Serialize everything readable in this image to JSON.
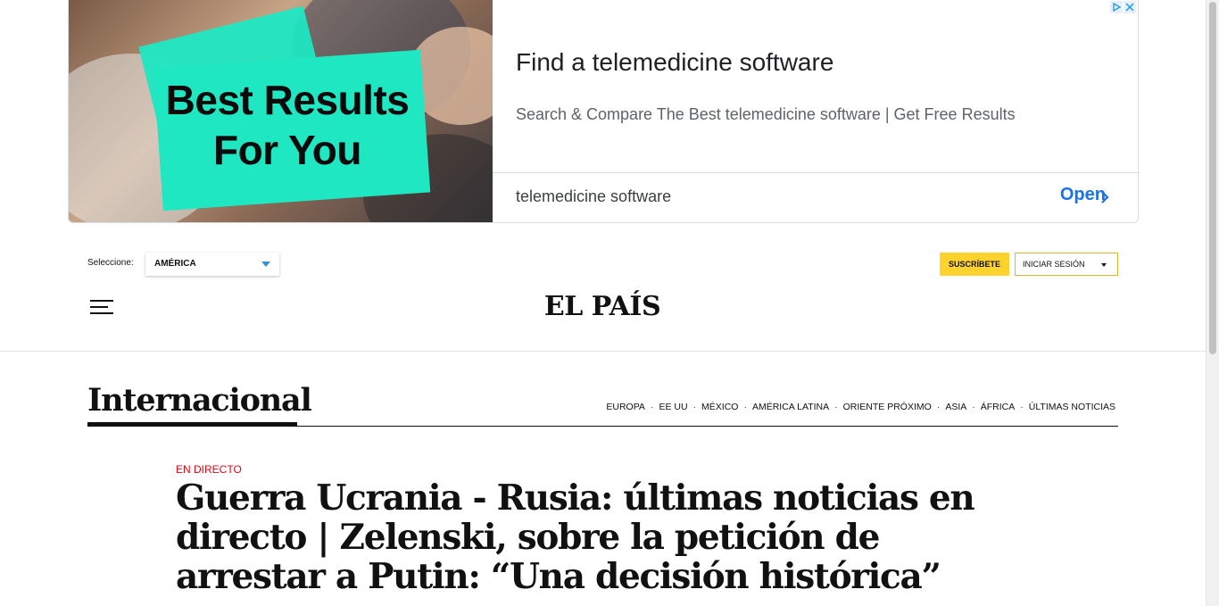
{
  "ad": {
    "image_headline": "Best Results For You",
    "title": "Find a telemedicine software",
    "description": "Search & Compare The Best telemedicine software | Get Free Results",
    "keyword": "telemedicine software",
    "cta": "Open",
    "accent_color": "#1fe7c2",
    "cta_color": "#1a73e8"
  },
  "header": {
    "region_label": "Seleccione:",
    "region_value": "AMÉRICA",
    "subscribe_label": "SUSCRÍBETE",
    "login_label": "INICIAR SESIÓN",
    "logo": "EL PAÍS",
    "subscribe_color": "#ffd22e"
  },
  "section": {
    "title": "Internacional",
    "nav": [
      "EUROPA",
      "EE UU",
      "MÉXICO",
      "AMÉRICA LATINA",
      "ORIENTE PRÓXIMO",
      "ASIA",
      "ÁFRICA",
      "ÚLTIMAS NOTICIAS"
    ]
  },
  "article": {
    "kicker": "EN DIRECTO",
    "kicker_color": "#e30613",
    "headline": "Guerra Ucrania - Rusia: últimas noticias en directo | Zelenski, sobre la petición de arrestar a Putin: “Una decisión histórica”"
  }
}
